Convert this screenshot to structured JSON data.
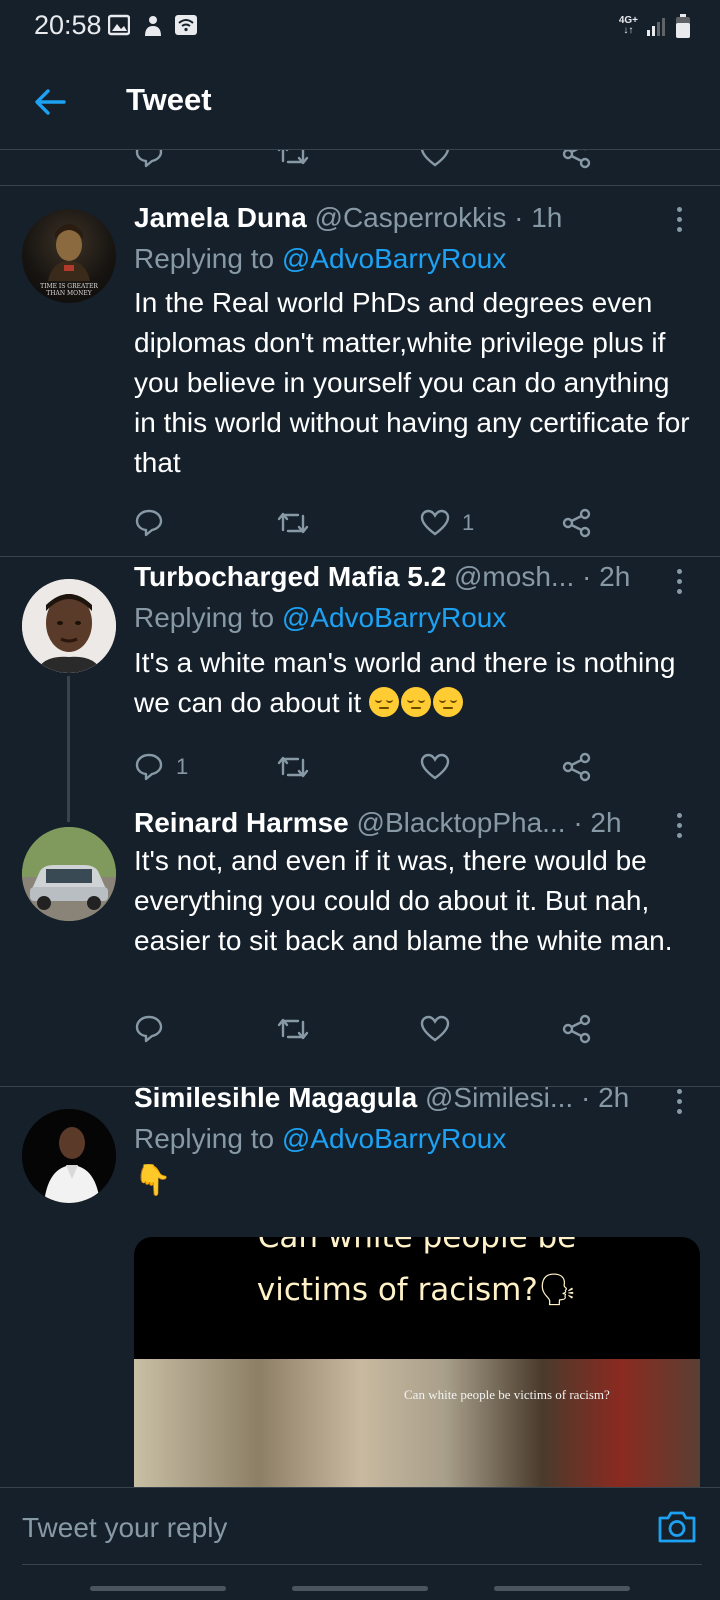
{
  "status_bar": {
    "time": "20:58",
    "network": "4G+",
    "icons": [
      "image-icon",
      "person-icon",
      "wifi-icon",
      "signal-icon",
      "battery-icon"
    ]
  },
  "header": {
    "title": "Tweet",
    "back_icon": "back-arrow-icon"
  },
  "colors": {
    "background": "#15202b",
    "accent": "#1da1f2",
    "muted": "#8899a6",
    "divider": "#38444d"
  },
  "tweets": [
    {
      "name": "Jamela Duna",
      "handle": "@Casperrokkis",
      "time": "· 1h",
      "replying_prefix": "Replying to ",
      "replying_to": "@AdvoBarryRoux",
      "text": "In the Real world PhDs and degrees even diplomas don't matter,white privilege plus if you believe in yourself you can do anything in this world without having any certificate for that",
      "reply_count": "",
      "like_count": "1",
      "avatar_text": "TIME IS GREATER THAN MONEY"
    },
    {
      "name": "Turbocharged Mafia 5.2",
      "handle": "@mosh...",
      "time": "· 2h",
      "replying_prefix": "Replying to ",
      "replying_to": "@AdvoBarryRoux",
      "text": "It's a white man's world and there is nothing we can do about it",
      "emoji_count": 3,
      "reply_count": "1",
      "like_count": ""
    },
    {
      "name": "Reinard Harmse",
      "handle": "@BlacktopPha...",
      "time": "· 2h",
      "text": "It's not, and even if it was, there would be everything you could do about it. But nah, easier to sit back and blame the white man.",
      "reply_count": "",
      "like_count": ""
    },
    {
      "name": "Similesihle Magagula",
      "handle": "@Similesi...",
      "time": "· 2h",
      "replying_prefix": "Replying to ",
      "replying_to": "@AdvoBarryRoux",
      "text": "👇",
      "media": {
        "caption_top": "Can white people be",
        "caption": "victims of racism?🗣",
        "subtitle": "Can white people be victims of racism?"
      }
    }
  ],
  "reply_bar": {
    "placeholder": "Tweet your reply",
    "camera_icon": "camera-icon"
  }
}
